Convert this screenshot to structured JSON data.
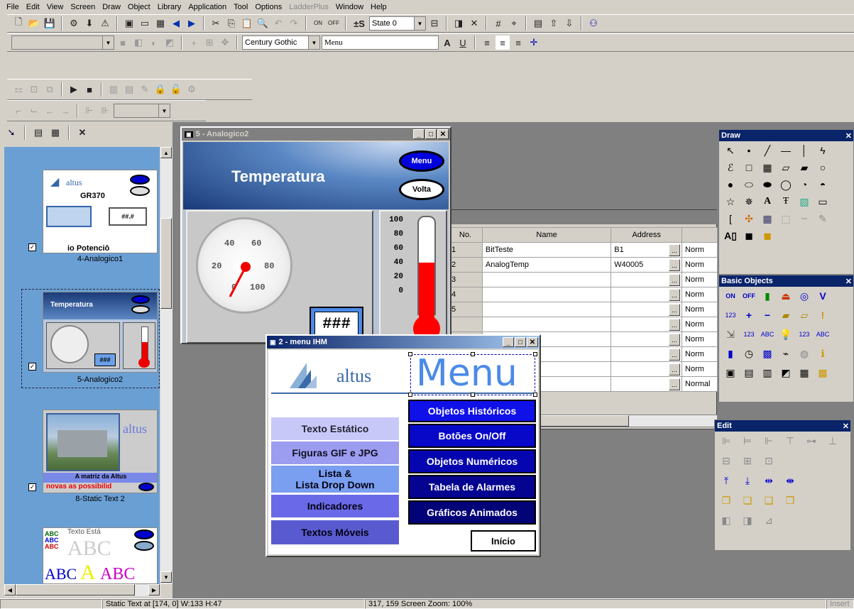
{
  "menubar": [
    "File",
    "Edit",
    "View",
    "Screen",
    "Draw",
    "Object",
    "Library",
    "Application",
    "Tool",
    "Options",
    "LadderPlus",
    "Window",
    "Help"
  ],
  "toolbar": {
    "state_label": "State 0",
    "font_name": "Century Gothic",
    "text_value": "Menu",
    "on_label": "ON",
    "off_label": "OFF",
    "pm_label": "±S"
  },
  "leftpanel": {
    "items": [
      {
        "label": "4-Analogico1",
        "thumb_title": "GR370",
        "thumb_brand": "altus",
        "thumb_sub": "io Potenciô",
        "thumb_val": "##.#"
      },
      {
        "label": "5-Analogico2",
        "thumb_title": "Temperatura",
        "thumb_val": "###"
      },
      {
        "label": "8-Static Text 2",
        "thumb_brand": "altus",
        "thumb_caption": "A matriz da Altus",
        "thumb_caption2": "novas as possibilid"
      },
      {
        "label": "",
        "thumb_title": "Texto Está"
      }
    ]
  },
  "win_analog": {
    "title": "5 - Analogico2",
    "heading": "Temperatura",
    "menu_btn": "Menu",
    "volta_btn": "Volta",
    "gauge_labels": [
      "20",
      "40",
      "60",
      "80",
      "0",
      "100"
    ],
    "thermo_labels": [
      "100",
      "80",
      "60",
      "40",
      "20",
      "0"
    ],
    "display": "###"
  },
  "tags_table": {
    "headers": [
      "No.",
      "Name",
      "Address",
      ""
    ],
    "rows": [
      {
        "no": "1",
        "name": "BitTeste",
        "addr": "B1",
        "type": "Norm"
      },
      {
        "no": "2",
        "name": "AnalogTemp",
        "addr": "W40005",
        "type": "Norm"
      },
      {
        "no": "3",
        "name": "",
        "addr": "",
        "type": "Norm"
      },
      {
        "no": "4",
        "name": "",
        "addr": "",
        "type": "Norm"
      },
      {
        "no": "5",
        "name": "",
        "addr": "",
        "type": "Norm"
      },
      {
        "no": "",
        "name": "",
        "addr": "",
        "type": "Norm"
      },
      {
        "no": "",
        "name": "",
        "addr": "",
        "type": "Norm"
      },
      {
        "no": "",
        "name": "",
        "addr": "",
        "type": "Norm"
      },
      {
        "no": "",
        "name": "",
        "addr": "",
        "type": "Norm"
      },
      {
        "no": "",
        "name": "",
        "addr": "",
        "type": "Normal"
      }
    ]
  },
  "win_menu": {
    "title": "2 - menu IHM",
    "brand": "altus",
    "menu_text": "Menu",
    "left_buttons": [
      "Texto Estático",
      "Figuras GIF e JPG",
      "Lista &\nLista Drop Down",
      "Indicadores",
      "Textos Móveis"
    ],
    "right_buttons": [
      "Objetos Históricos",
      "Botões On/Off",
      "Objetos Numéricos",
      "Tabela de Alarmes",
      "Gráficos Animados"
    ],
    "inicio": "Início"
  },
  "palettes": {
    "draw_title": "Draw",
    "basic_title": "Basic Objects",
    "edit_title": "Edit",
    "basic_on": "ON",
    "basic_off": "OFF"
  },
  "status": {
    "left": "Static Text  at [174, 0] W:133 H:47",
    "mid": "317, 159  Screen Zoom: 100%",
    "right": "Insert"
  },
  "colors": {
    "darkblue": "#0a246a",
    "leftpanel": "#6a9fd4",
    "btnblue": "#0000d0",
    "btnlight": "#c8c8f8"
  }
}
